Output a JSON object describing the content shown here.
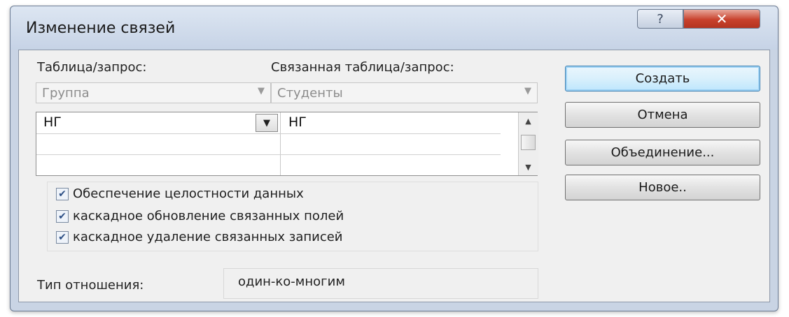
{
  "window": {
    "title": "Изменение связей",
    "help_glyph": "?",
    "close_glyph": "✕"
  },
  "left_table": {
    "label": "Таблица/запрос:",
    "value": "Группа"
  },
  "right_table": {
    "label": "Связанная таблица/запрос:",
    "value": "Студенты"
  },
  "fields_grid": {
    "rows": [
      {
        "left": "НГ",
        "right": "НГ"
      },
      {
        "left": "",
        "right": ""
      },
      {
        "left": "",
        "right": ""
      }
    ]
  },
  "options": [
    {
      "label": "Обеспечение целостности данных",
      "checked": true
    },
    {
      "label": "каскадное обновление связанных полей",
      "checked": true
    },
    {
      "label": "каскадное удаление связанных записей",
      "checked": true
    }
  ],
  "relation_type": {
    "label": "Тип отношения:",
    "value": "один-ко-многим"
  },
  "buttons": {
    "create": "Создать",
    "cancel": "Отмена",
    "join": "Объединение...",
    "new": "Новое.."
  },
  "icons": {
    "dropdown": "chevron-down-icon",
    "checkbox": "check-icon",
    "scroll_up": "triangle-up-icon",
    "scroll_down": "triangle-down-icon"
  },
  "colors": {
    "window_frame": "#c9d4e4",
    "close_button": "#c8412c",
    "default_button_border": "#3c7fb1",
    "checkbox_mark": "#2d4f85"
  }
}
